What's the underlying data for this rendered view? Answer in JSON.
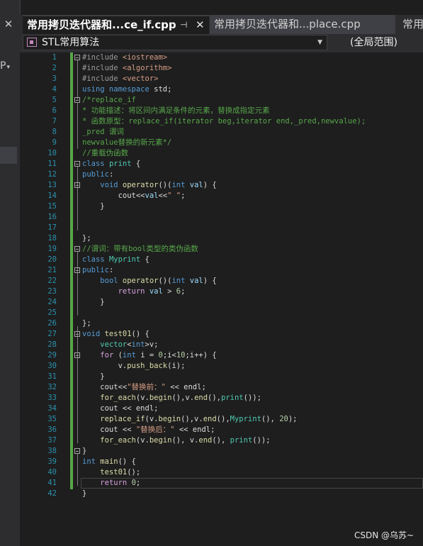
{
  "tabs": [
    {
      "label": "常用拷贝迭代器和...ce_if.cpp",
      "pin": "⊣",
      "close": "✕"
    },
    {
      "label": "常用拷贝迭代器和...place.cpp"
    },
    {
      "label": "常用"
    }
  ],
  "nav": {
    "scope_class": "STL常用算法",
    "scope_global": "(全局范围)"
  },
  "left_panel": {
    "close": "✕",
    "item": "P"
  },
  "code_lines": [
    [
      [
        "pp",
        "#include "
      ],
      [
        "inc",
        "<iostream>"
      ]
    ],
    [
      [
        "pp",
        "#include "
      ],
      [
        "inc",
        "<algorithm>"
      ]
    ],
    [
      [
        "pp",
        "#include "
      ],
      [
        "inc",
        "<vector>"
      ]
    ],
    [
      [
        "kw",
        "using namespace "
      ],
      [
        "plain",
        "std;"
      ]
    ],
    [
      [
        "cm",
        "/*replace_if"
      ]
    ],
    [
      [
        "cm",
        "* 功能描述：将区间内满足条件的元素，替换成指定元素"
      ]
    ],
    [
      [
        "cm",
        "* 函数原型：replace_if(iterator beg,iterator end,_pred,newvalue);"
      ]
    ],
    [
      [
        "cm",
        "_pred 谓词"
      ]
    ],
    [
      [
        "cm",
        "newvalue替换的新元素*/"
      ]
    ],
    [
      [
        "cm",
        "//重载伪函数"
      ]
    ],
    [
      [
        "kw",
        "class "
      ],
      [
        "ty",
        "print"
      ],
      [
        "plain",
        " {"
      ]
    ],
    [
      [
        "kw",
        "public"
      ],
      [
        "plain",
        ":"
      ]
    ],
    [
      [
        "plain",
        "    "
      ],
      [
        "kw",
        "void "
      ],
      [
        "fn",
        "operator"
      ],
      [
        "plain",
        "()("
      ],
      [
        "kw",
        "int "
      ],
      [
        "var",
        "val"
      ],
      [
        "plain",
        ") {"
      ]
    ],
    [
      [
        "plain",
        "        cout<<"
      ],
      [
        "var",
        "val"
      ],
      [
        "plain",
        "<<"
      ],
      [
        "str",
        "\" \""
      ],
      [
        "plain",
        ";"
      ]
    ],
    [
      [
        "plain",
        "    }"
      ]
    ],
    [
      [
        "plain",
        ""
      ]
    ],
    [
      [
        "plain",
        ""
      ]
    ],
    [
      [
        "plain",
        "};"
      ]
    ],
    [
      [
        "cm",
        "//谓词：带有bool类型的类伪函数"
      ]
    ],
    [
      [
        "kw",
        "class "
      ],
      [
        "ty",
        "Myprint"
      ],
      [
        "plain",
        " {"
      ]
    ],
    [
      [
        "kw",
        "public"
      ],
      [
        "plain",
        ":"
      ]
    ],
    [
      [
        "plain",
        "    "
      ],
      [
        "kw",
        "bool "
      ],
      [
        "fn",
        "operator"
      ],
      [
        "plain",
        "()("
      ],
      [
        "kw",
        "int "
      ],
      [
        "var",
        "val"
      ],
      [
        "plain",
        ") {"
      ]
    ],
    [
      [
        "plain",
        "        "
      ],
      [
        "ctl",
        "return "
      ],
      [
        "var",
        "val"
      ],
      [
        "plain",
        " > "
      ],
      [
        "num",
        "6"
      ],
      [
        "plain",
        ";"
      ]
    ],
    [
      [
        "plain",
        "    }"
      ]
    ],
    [
      [
        "plain",
        ""
      ]
    ],
    [
      [
        "plain",
        "};"
      ]
    ],
    [
      [
        "kw",
        "void "
      ],
      [
        "fn",
        "test01"
      ],
      [
        "plain",
        "() {"
      ]
    ],
    [
      [
        "plain",
        "    "
      ],
      [
        "ty",
        "vector"
      ],
      [
        "plain",
        "<"
      ],
      [
        "kw",
        "int"
      ],
      [
        "plain",
        ">v;"
      ]
    ],
    [
      [
        "plain",
        "    "
      ],
      [
        "ctl",
        "for "
      ],
      [
        "plain",
        "("
      ],
      [
        "kw",
        "int "
      ],
      [
        "plain",
        "i = "
      ],
      [
        "num",
        "0"
      ],
      [
        "plain",
        ";i<"
      ],
      [
        "num",
        "10"
      ],
      [
        "plain",
        ";i++) {"
      ]
    ],
    [
      [
        "plain",
        "        v."
      ],
      [
        "fn",
        "push_back"
      ],
      [
        "plain",
        "(i);"
      ]
    ],
    [
      [
        "plain",
        "    }"
      ]
    ],
    [
      [
        "plain",
        "    cout<<"
      ],
      [
        "str",
        "\"替换前：\""
      ],
      [
        "plain",
        " << endl;"
      ]
    ],
    [
      [
        "plain",
        "    "
      ],
      [
        "fn",
        "for_each"
      ],
      [
        "plain",
        "(v."
      ],
      [
        "fn",
        "begin"
      ],
      [
        "plain",
        "(),v."
      ],
      [
        "fn",
        "end"
      ],
      [
        "plain",
        "(),"
      ],
      [
        "ty",
        "print"
      ],
      [
        "plain",
        "());"
      ]
    ],
    [
      [
        "plain",
        "    cout << endl;"
      ]
    ],
    [
      [
        "plain",
        "    "
      ],
      [
        "fn",
        "replace_if"
      ],
      [
        "plain",
        "(v."
      ],
      [
        "fn",
        "begin"
      ],
      [
        "plain",
        "(),v."
      ],
      [
        "fn",
        "end"
      ],
      [
        "plain",
        "(),"
      ],
      [
        "ty",
        "Myprint"
      ],
      [
        "plain",
        "(), "
      ],
      [
        "num",
        "20"
      ],
      [
        "plain",
        ");"
      ]
    ],
    [
      [
        "plain",
        "    cout << "
      ],
      [
        "str",
        "\"替换后：\""
      ],
      [
        "plain",
        " << endl;"
      ]
    ],
    [
      [
        "plain",
        "    "
      ],
      [
        "fn",
        "for_each"
      ],
      [
        "plain",
        "(v."
      ],
      [
        "fn",
        "begin"
      ],
      [
        "plain",
        "(), v."
      ],
      [
        "fn",
        "end"
      ],
      [
        "plain",
        "(), "
      ],
      [
        "ty",
        "print"
      ],
      [
        "plain",
        "());"
      ]
    ],
    [
      [
        "plain",
        "}"
      ]
    ],
    [
      [
        "kw",
        "int "
      ],
      [
        "fn",
        "main"
      ],
      [
        "plain",
        "() {"
      ]
    ],
    [
      [
        "plain",
        "    "
      ],
      [
        "fn",
        "test01"
      ],
      [
        "plain",
        "();"
      ]
    ],
    [
      [
        "plain",
        "    "
      ],
      [
        "ctl",
        "return "
      ],
      [
        "num",
        "0"
      ],
      [
        "plain",
        ";"
      ]
    ],
    [
      [
        "plain",
        "}"
      ]
    ]
  ],
  "watermark": "CSDN @乌苏~"
}
